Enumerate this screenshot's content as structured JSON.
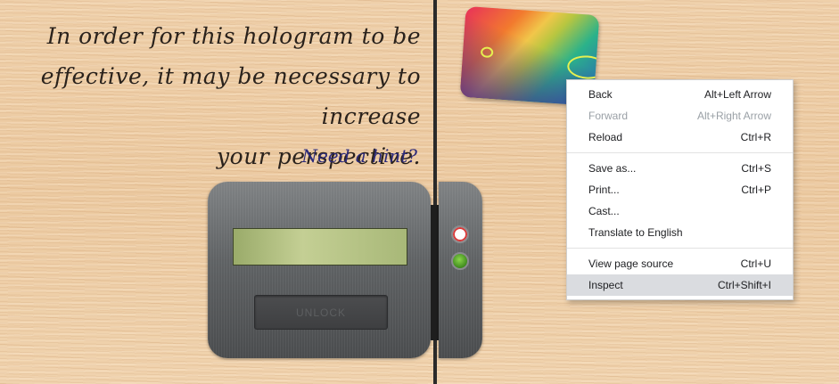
{
  "puzzle": {
    "message_lines": [
      "In order for this hologram to be",
      "effective, it may be necessary to increase",
      "your perspective."
    ],
    "hint_link": "Need a hint?"
  },
  "lock": {
    "unlock_label": "UNLOCK",
    "screen_value": "",
    "led_colors": {
      "red": "#d93a3a",
      "green": "#5cb82e"
    }
  },
  "context_menu": {
    "groups": [
      [
        {
          "label": "Back",
          "shortcut": "Alt+Left Arrow",
          "disabled": false
        },
        {
          "label": "Forward",
          "shortcut": "Alt+Right Arrow",
          "disabled": true
        },
        {
          "label": "Reload",
          "shortcut": "Ctrl+R",
          "disabled": false
        }
      ],
      [
        {
          "label": "Save as...",
          "shortcut": "Ctrl+S",
          "disabled": false
        },
        {
          "label": "Print...",
          "shortcut": "Ctrl+P",
          "disabled": false
        },
        {
          "label": "Cast...",
          "shortcut": "",
          "disabled": false
        },
        {
          "label": "Translate to English",
          "shortcut": "",
          "disabled": false
        }
      ],
      [
        {
          "label": "View page source",
          "shortcut": "Ctrl+U",
          "disabled": false
        },
        {
          "label": "Inspect",
          "shortcut": "Ctrl+Shift+I",
          "disabled": false,
          "selected": true
        }
      ]
    ]
  }
}
